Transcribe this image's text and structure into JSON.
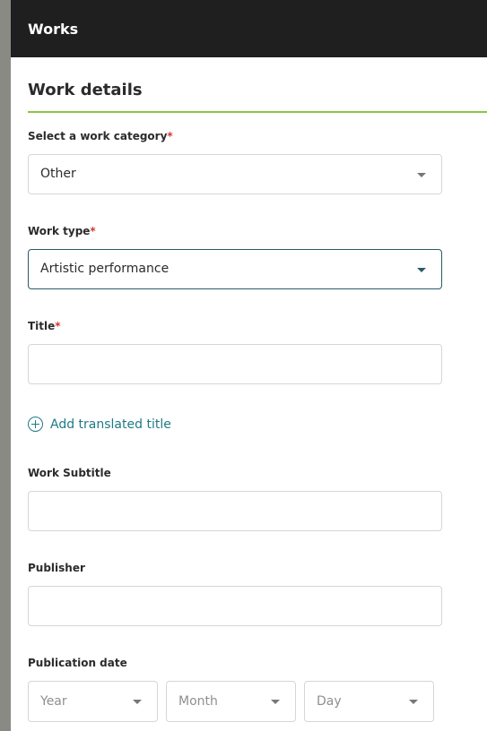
{
  "header": {
    "title": "Works"
  },
  "section": {
    "title": "Work details"
  },
  "form": {
    "category": {
      "label": "Select a work category",
      "required_mark": "*",
      "value": "Other"
    },
    "work_type": {
      "label": "Work type",
      "required_mark": "*",
      "value": "Artistic performance"
    },
    "title": {
      "label": "Title",
      "required_mark": "*",
      "value": ""
    },
    "add_translated_title": "Add translated title",
    "subtitle": {
      "label": "Work Subtitle",
      "value": ""
    },
    "publisher": {
      "label": "Publisher",
      "value": ""
    },
    "publication_date": {
      "label": "Publication date",
      "year": "Year",
      "month": "Month",
      "day": "Day"
    }
  },
  "colors": {
    "accent": "#8cc63f",
    "required": "#d13838",
    "link": "#1f7a85",
    "header_bg": "#1f1f1f"
  }
}
